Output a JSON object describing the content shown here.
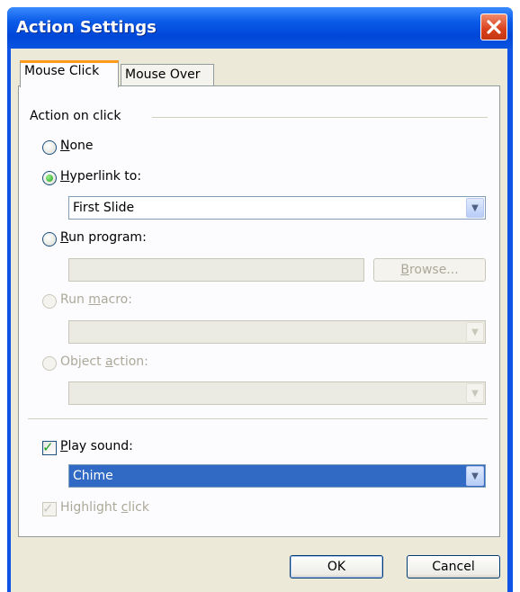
{
  "window": {
    "title": "Action Settings"
  },
  "icons": {
    "close": "close-icon",
    "dropdown": "chevron-down-icon",
    "check": "checkmark-icon"
  },
  "tabs": [
    {
      "label": "Mouse Click",
      "active": true
    },
    {
      "label": "Mouse Over",
      "active": false
    }
  ],
  "group": {
    "title": "Action on click"
  },
  "options": {
    "none": {
      "mnemonic": "N",
      "rest": "one",
      "selected": false,
      "enabled": true
    },
    "hyperlink": {
      "mnemonic": "H",
      "rest": "yperlink to:",
      "selected": true,
      "enabled": true
    },
    "run_program": {
      "mnemonic": "R",
      "rest": "un program:",
      "selected": false,
      "enabled": true
    },
    "run_macro": {
      "pre": "Run ",
      "mnemonic": "m",
      "rest": "acro:",
      "selected": false,
      "enabled": false
    },
    "object_action": {
      "pre": "Object ",
      "mnemonic": "a",
      "rest": "ction:",
      "selected": false,
      "enabled": false
    }
  },
  "hyperlink_combo": {
    "value": "First Slide"
  },
  "program_field": {
    "value": ""
  },
  "browse_button": {
    "mnemonic": "B",
    "rest": "rowse..."
  },
  "macro_combo": {
    "value": ""
  },
  "object_combo": {
    "value": ""
  },
  "play_sound": {
    "mnemonic": "P",
    "rest": "lay sound:",
    "checked": true
  },
  "sound_combo": {
    "value": "Chime"
  },
  "highlight": {
    "pre": "Highlight ",
    "mnemonic": "c",
    "rest": "lick",
    "checked": true,
    "enabled": false
  },
  "buttons": {
    "ok": "OK",
    "cancel": "Cancel"
  },
  "colors": {
    "title_bar": "#0a5ae8",
    "accent": "#316ac5",
    "tab_highlight": "#ff9a1a",
    "close": "#d9411c"
  }
}
